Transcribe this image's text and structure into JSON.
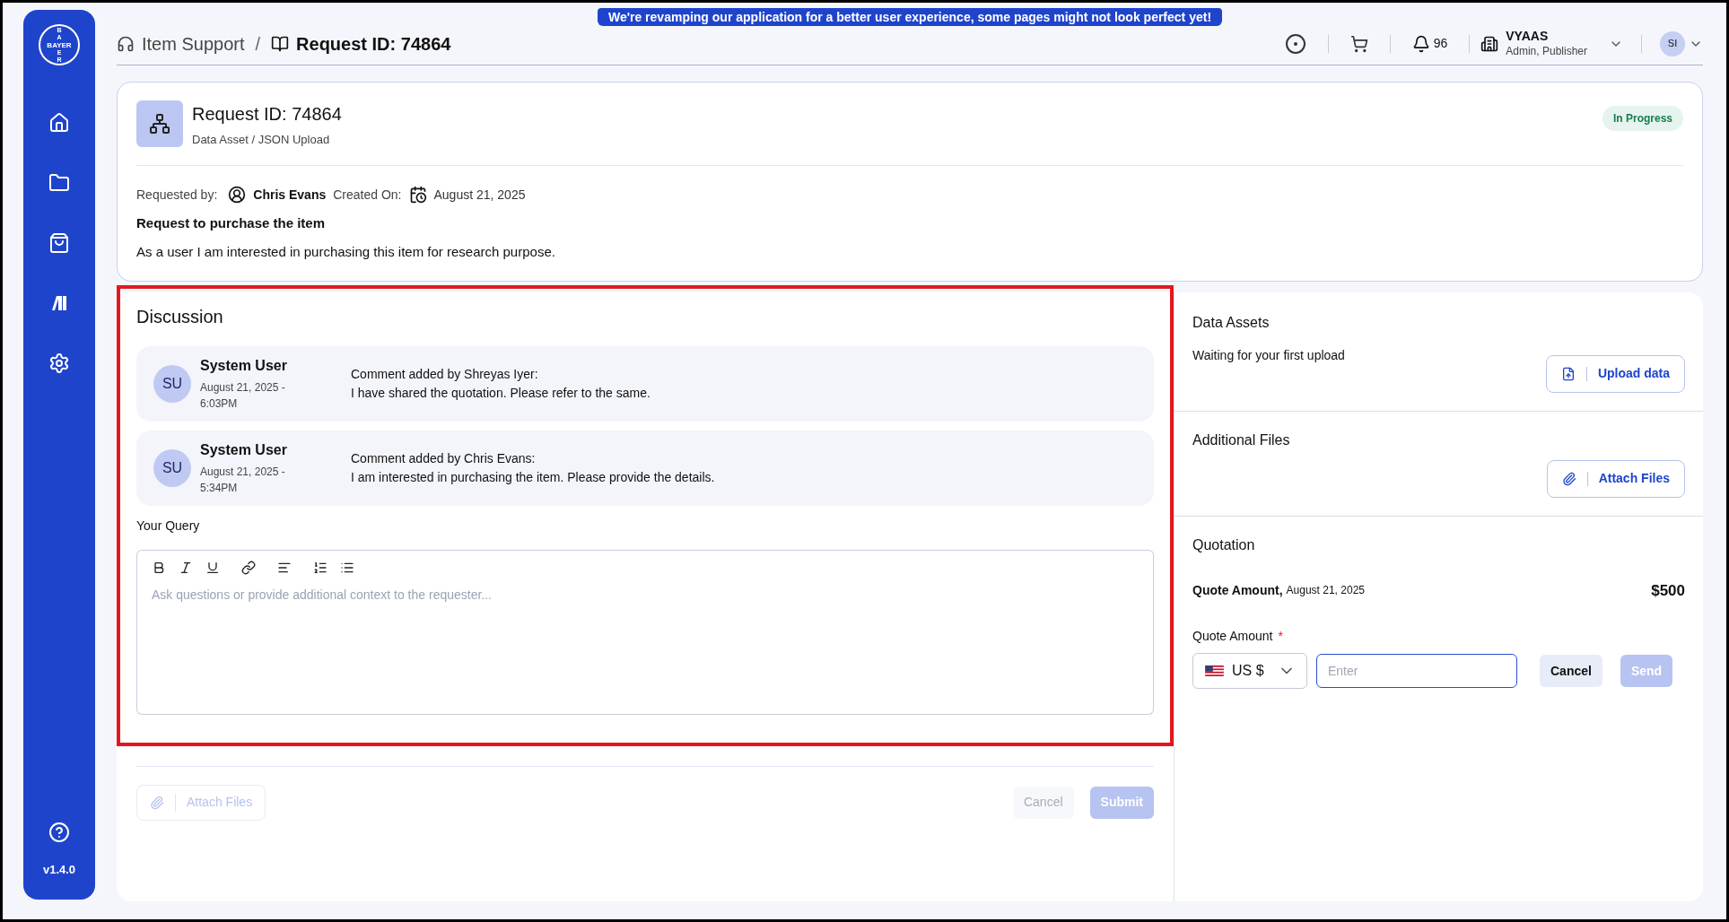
{
  "banner": "We're revamping our application for a better user experience, some pages might not look perfect yet!",
  "sidebar": {
    "logo": {
      "top": "BA",
      "middle": "BAYER",
      "bottom": "ER"
    },
    "items": [
      {
        "kind": "home"
      },
      {
        "kind": "folder"
      },
      {
        "kind": "bag"
      },
      {
        "kind": "library"
      },
      {
        "kind": "settings"
      }
    ],
    "version": "v1.4.0"
  },
  "breadcrumb": [
    {
      "label": "Item Support"
    },
    {
      "label": "Request ID: 74864"
    }
  ],
  "breadcrumb_separator": "/",
  "header": {
    "notifications": "96",
    "org": "VYAAS",
    "roles": "Admin, Publisher",
    "avatar": "SI"
  },
  "request": {
    "title": "Request ID: 74864",
    "subtitle": "Data Asset / JSON Upload",
    "status": "In Progress",
    "requested_by_label": "Requested by:",
    "requester": "Chris Evans",
    "created_label": "Created On:",
    "created": "August 21, 2025",
    "heading": "Request to purchase the item",
    "description": "As a user I am interested in purchasing this item for research purpose."
  },
  "discussion": {
    "title": "Discussion",
    "comments": [
      {
        "initials": "SU",
        "author": "System User",
        "date": "August 21, 2025 -",
        "time": "6:03PM",
        "by": "Comment added by Shreyas Iyer:",
        "text": "I have shared the quotation. Please refer to the same."
      },
      {
        "initials": "SU",
        "author": "System User",
        "date": "August 21, 2025 -",
        "time": "5:34PM",
        "by": "Comment added by Chris Evans:",
        "text": "I am interested in purchasing the item. Please provide the details."
      }
    ],
    "query_label": "Your Query",
    "placeholder": "Ask questions or provide additional context to the requester...",
    "attach": {
      "label": "Attach Files",
      "disabled": true
    },
    "cancel": {
      "label": "Cancel",
      "disabled": true
    },
    "submit": {
      "label": "Submit",
      "disabled": true
    }
  },
  "data_assets": {
    "title": "Data Assets",
    "text": "Waiting for your first upload",
    "button": "Upload data"
  },
  "additional_files": {
    "title": "Additional Files",
    "button": "Attach Files"
  },
  "quotation": {
    "title": "Quotation",
    "quote_label": "Quote Amount,",
    "quote_date": "August 21, 2025",
    "amount": "$500",
    "field_label": "Quote Amount",
    "required": "*",
    "currency": "US $",
    "placeholder": "Enter",
    "cancel": {
      "label": "Cancel",
      "disabled": false
    },
    "send": {
      "label": "Send",
      "disabled": true
    }
  }
}
